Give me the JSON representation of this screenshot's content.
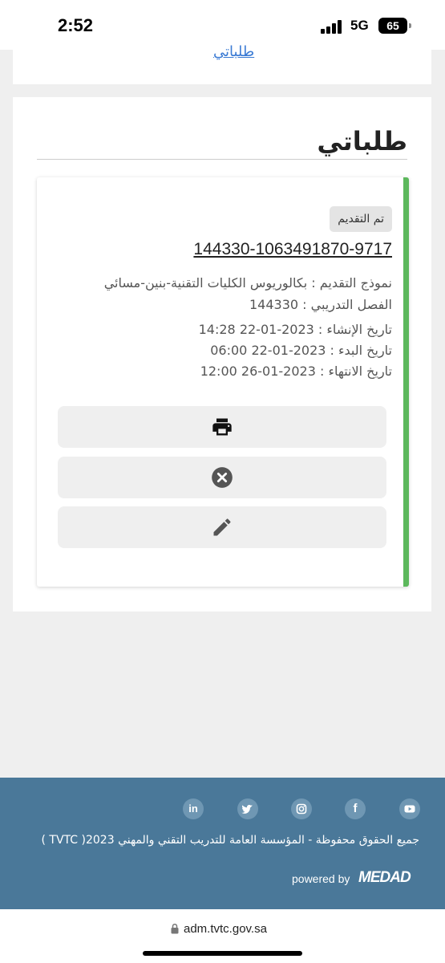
{
  "status_bar": {
    "time": "2:52",
    "network": "5G",
    "battery": "65"
  },
  "top_card": {
    "link_text": "طلباتي"
  },
  "section": {
    "title": "طلباتي"
  },
  "application": {
    "status": "تم التقديم",
    "number": "144330-1063491870-9717",
    "form_line": "نموذج التقديم : بكالوريوس الكليات التقنية-بنين-مسائي",
    "term_line": "الفصل التدريبي : 144330",
    "created_line": "تاريخ الإنشاء : 2023-01-22 14:28",
    "start_line": "تاريخ البدء : 2023-01-22 06:00",
    "end_line": "تاريخ الانتهاء : 2023-01-26 12:00"
  },
  "actions": [
    {
      "icon": "print-icon"
    },
    {
      "icon": "cancel-icon"
    },
    {
      "icon": "edit-icon"
    }
  ],
  "footer": {
    "social_icons": [
      "youtube-icon",
      "facebook-icon",
      "instagram-icon",
      "twitter-icon",
      "linkedin-icon"
    ],
    "linkedin_glyph": "in",
    "facebook_glyph": "f",
    "copyright": "جميع الحقوق محفوظة - المؤسسة العامة للتدريب التقني والمهني 2023( TVTC )",
    "powered_by": "powered by",
    "brand": "MEDAD"
  },
  "address_bar": {
    "url": "adm.tvtc.gov.sa"
  },
  "colors": {
    "accent": "#5cb85c",
    "footer": "#4a7899",
    "link": "#3b7bd4"
  }
}
